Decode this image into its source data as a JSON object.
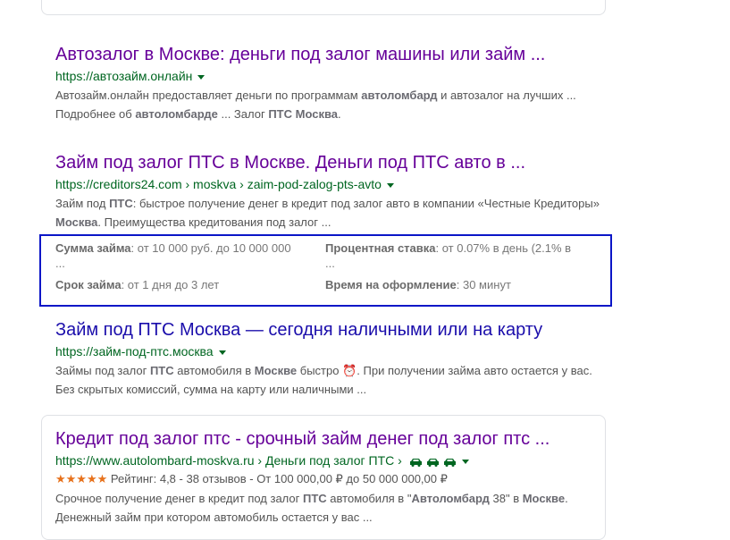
{
  "results": [
    {
      "title": "Автозалог в Москве: деньги под залог машины или займ ...",
      "url": "https://автозайм.онлайн",
      "snippet_parts": [
        {
          "t": "Автозайм.онлайн предоставляет деньги по программам ",
          "b": false
        },
        {
          "t": "автоломбард",
          "b": true
        },
        {
          "t": " и автозалог на лучших ... Подробнее об ",
          "b": false
        },
        {
          "t": "автоломбарде",
          "b": true
        },
        {
          "t": " ... Залог ",
          "b": false
        },
        {
          "t": "ПТС Москва",
          "b": true
        },
        {
          "t": ".",
          "b": false
        }
      ]
    },
    {
      "title": "Займ под залог ПТС в Москве. Деньги под ПТС авто в ...",
      "url": "https://creditors24.com › moskva › zaim-pod-zalog-pts-avto",
      "snippet_parts": [
        {
          "t": "Займ под ",
          "b": false
        },
        {
          "t": "ПТС",
          "b": true
        },
        {
          "t": ": быстрое получение денег в кредит под залог авто в компании «Честные Кредиторы» ",
          "b": false
        },
        {
          "t": "Москва",
          "b": true
        },
        {
          "t": ". Преимущества кредитования под залог ...",
          "b": false
        }
      ],
      "facts": [
        {
          "label": "Сумма займа",
          "value": ": от 10 000 руб. до 10 000 000",
          "more": "..."
        },
        {
          "label": "Процентная ставка",
          "value": ": от 0.07% в день (2.1% в",
          "more": "..."
        },
        {
          "label": "Срок займа",
          "value": ": от 1 дня до 3 лет",
          "more": ""
        },
        {
          "label": "Время на оформление",
          "value": ": 30 минут",
          "more": ""
        }
      ]
    },
    {
      "title": "Займ под ПТС Москва — сегодня наличными или на карту",
      "url": "https://займ-под-птс.москва",
      "snippet_parts": [
        {
          "t": "Займы под залог ",
          "b": false
        },
        {
          "t": "ПТС",
          "b": true
        },
        {
          "t": " автомобиля в ",
          "b": false
        },
        {
          "t": "Москве",
          "b": true
        },
        {
          "t": " быстро ⏰. При получении займа авто остается у вас. Без скрытых комиссий, сумма на карту или наличными ...",
          "b": false
        }
      ]
    },
    {
      "title": "Кредит под залог птс - срочный займ денег под залог птс ...",
      "url": "https://www.autolombard-moskva.ru › Деньги под залог ПТС ›",
      "rating_stars": "★★★★★",
      "rating_text": " Рейтинг: 4,8 - 38 отзывов - От 100 000,00 ₽ до 50 000 000,00 ₽",
      "snippet_parts": [
        {
          "t": "Срочное получение денег в кредит под залог ",
          "b": false
        },
        {
          "t": "ПТС",
          "b": true
        },
        {
          "t": " автомобиля в \"",
          "b": false
        },
        {
          "t": "Автоломбард",
          "b": true
        },
        {
          "t": " 38\" в ",
          "b": false
        },
        {
          "t": "Москве",
          "b": true
        },
        {
          "t": ". Денежный займ при котором автомобиль остается у вас ...",
          "b": false
        }
      ]
    }
  ],
  "colors": {
    "visited": "#660099",
    "link": "#1a0dab",
    "url": "#006621",
    "highlight_box": "#0b16c7",
    "stars": "#e7711b"
  },
  "icons": {
    "caret": "dropdown-caret-icon",
    "car": "car-icon",
    "alarm": "alarm-clock-emoji"
  }
}
